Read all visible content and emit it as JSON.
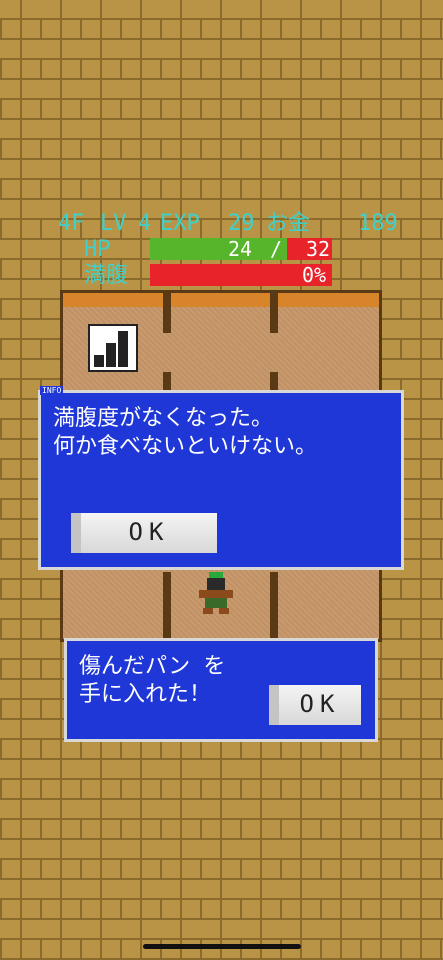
{
  "hud": {
    "floor": "4F",
    "lv_label": "LV",
    "lv_value": "4",
    "exp_label": "EXP",
    "exp_value": "29",
    "gold_label": "お金",
    "gold_value": "189",
    "hp_label": "HP",
    "hp_current": "24",
    "hp_sep": "/",
    "hp_max": "32",
    "hp_fraction": 0.75,
    "hunger_label": "満腹",
    "hunger_value": "0%",
    "hunger_fraction": 0.0
  },
  "colors": {
    "hud_text": "#3fd1c9",
    "hp_fill": "#56b52a",
    "hp_empty": "#e8242a",
    "dialog_bg": "#1e37d6"
  },
  "info_dialog": {
    "tag": "INFO",
    "line1": "満腹度がなくなった。",
    "line2": "何か食べないといけない。",
    "ok_label": "OK"
  },
  "item_dialog": {
    "line1": "傷んだパン を",
    "line2": "手に入れた！",
    "ok_label": "OK"
  },
  "icons": {
    "stairs": "stairs-icon",
    "player": "player-character-icon"
  }
}
